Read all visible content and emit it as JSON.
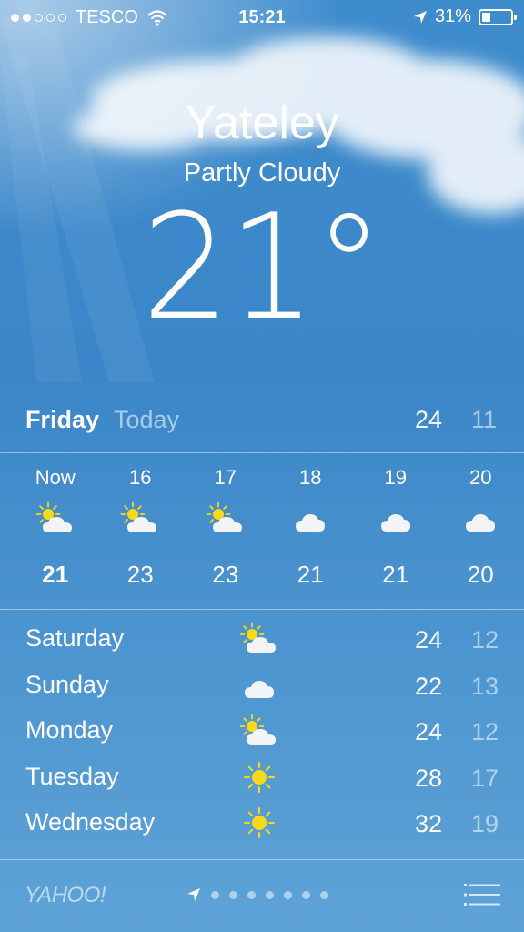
{
  "status_bar": {
    "carrier": "TESCO",
    "time": "15:21",
    "battery": "31%"
  },
  "weather": {
    "city": "Yateley",
    "condition": "Partly Cloudy",
    "temperature": "21°"
  },
  "today": {
    "day": "Friday",
    "label": "Today",
    "high": "24",
    "low": "11"
  },
  "hourly": [
    {
      "time": "Now",
      "icon": "partly-cloudy-icon",
      "temp": "21"
    },
    {
      "time": "16",
      "icon": "partly-cloudy-icon",
      "temp": "23"
    },
    {
      "time": "17",
      "icon": "partly-cloudy-icon",
      "temp": "23"
    },
    {
      "time": "18",
      "icon": "cloud-icon",
      "temp": "21"
    },
    {
      "time": "19",
      "icon": "cloud-icon",
      "temp": "21"
    },
    {
      "time": "20",
      "icon": "cloud-icon",
      "temp": "20"
    }
  ],
  "daily": [
    {
      "day": "Saturday",
      "icon": "partly-cloudy-icon",
      "high": "24",
      "low": "12"
    },
    {
      "day": "Sunday",
      "icon": "cloud-icon",
      "high": "22",
      "low": "13"
    },
    {
      "day": "Monday",
      "icon": "partly-cloudy-icon",
      "high": "24",
      "low": "12"
    },
    {
      "day": "Tuesday",
      "icon": "sun-icon",
      "high": "28",
      "low": "17"
    },
    {
      "day": "Wednesday",
      "icon": "sun-icon",
      "high": "32",
      "low": "19"
    }
  ],
  "footer": {
    "brand": "YAHOO!",
    "page_count": 7
  },
  "colors": {
    "sky": "#3f8ccd",
    "sun": "#f7d91a"
  }
}
